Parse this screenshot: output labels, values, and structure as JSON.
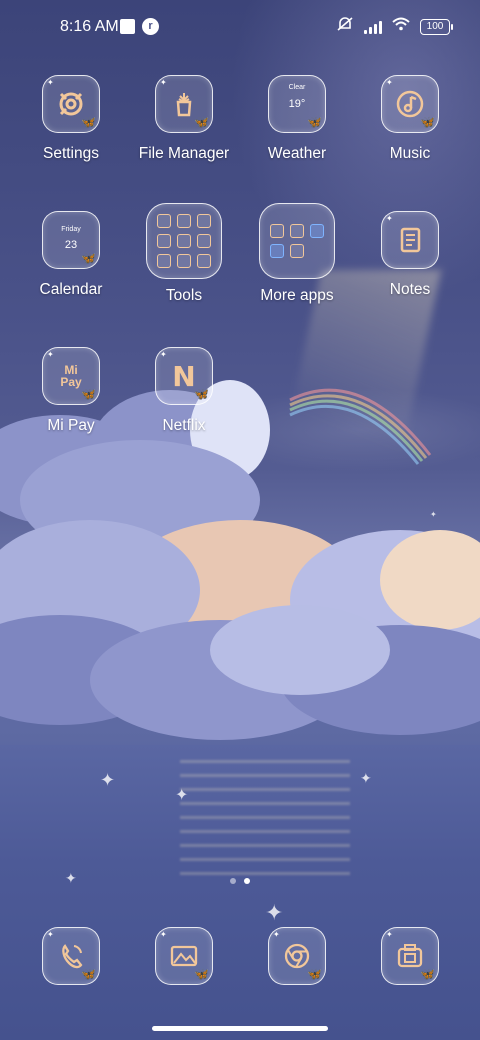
{
  "status_bar": {
    "time": "8:16 AM",
    "app_badge": "r",
    "battery": "100",
    "icons": [
      "notification-square-icon",
      "app-notification-icon",
      "mute-icon",
      "signal-icon",
      "wifi-icon",
      "battery-icon"
    ]
  },
  "apps": {
    "settings": "Settings",
    "file_manager": "File Manager",
    "weather": "Weather",
    "weather_condition": "Clear",
    "weather_temp": "19°",
    "music": "Music",
    "calendar": "Calendar",
    "calendar_day": "Friday",
    "calendar_date": "23",
    "tools": "Tools",
    "more_apps": "More apps",
    "notes": "Notes",
    "mi_pay": "Mi Pay",
    "mi_pay_icon_text": "Mi Pay",
    "netflix": "Netflix",
    "netflix_icon_text": "N"
  },
  "dock": {
    "icons": [
      "phone-icon",
      "gallery-icon",
      "chrome-icon",
      "camera-icon"
    ]
  },
  "colors": {
    "accent_glow": "#f2c79a",
    "sky": "#4a5289"
  }
}
